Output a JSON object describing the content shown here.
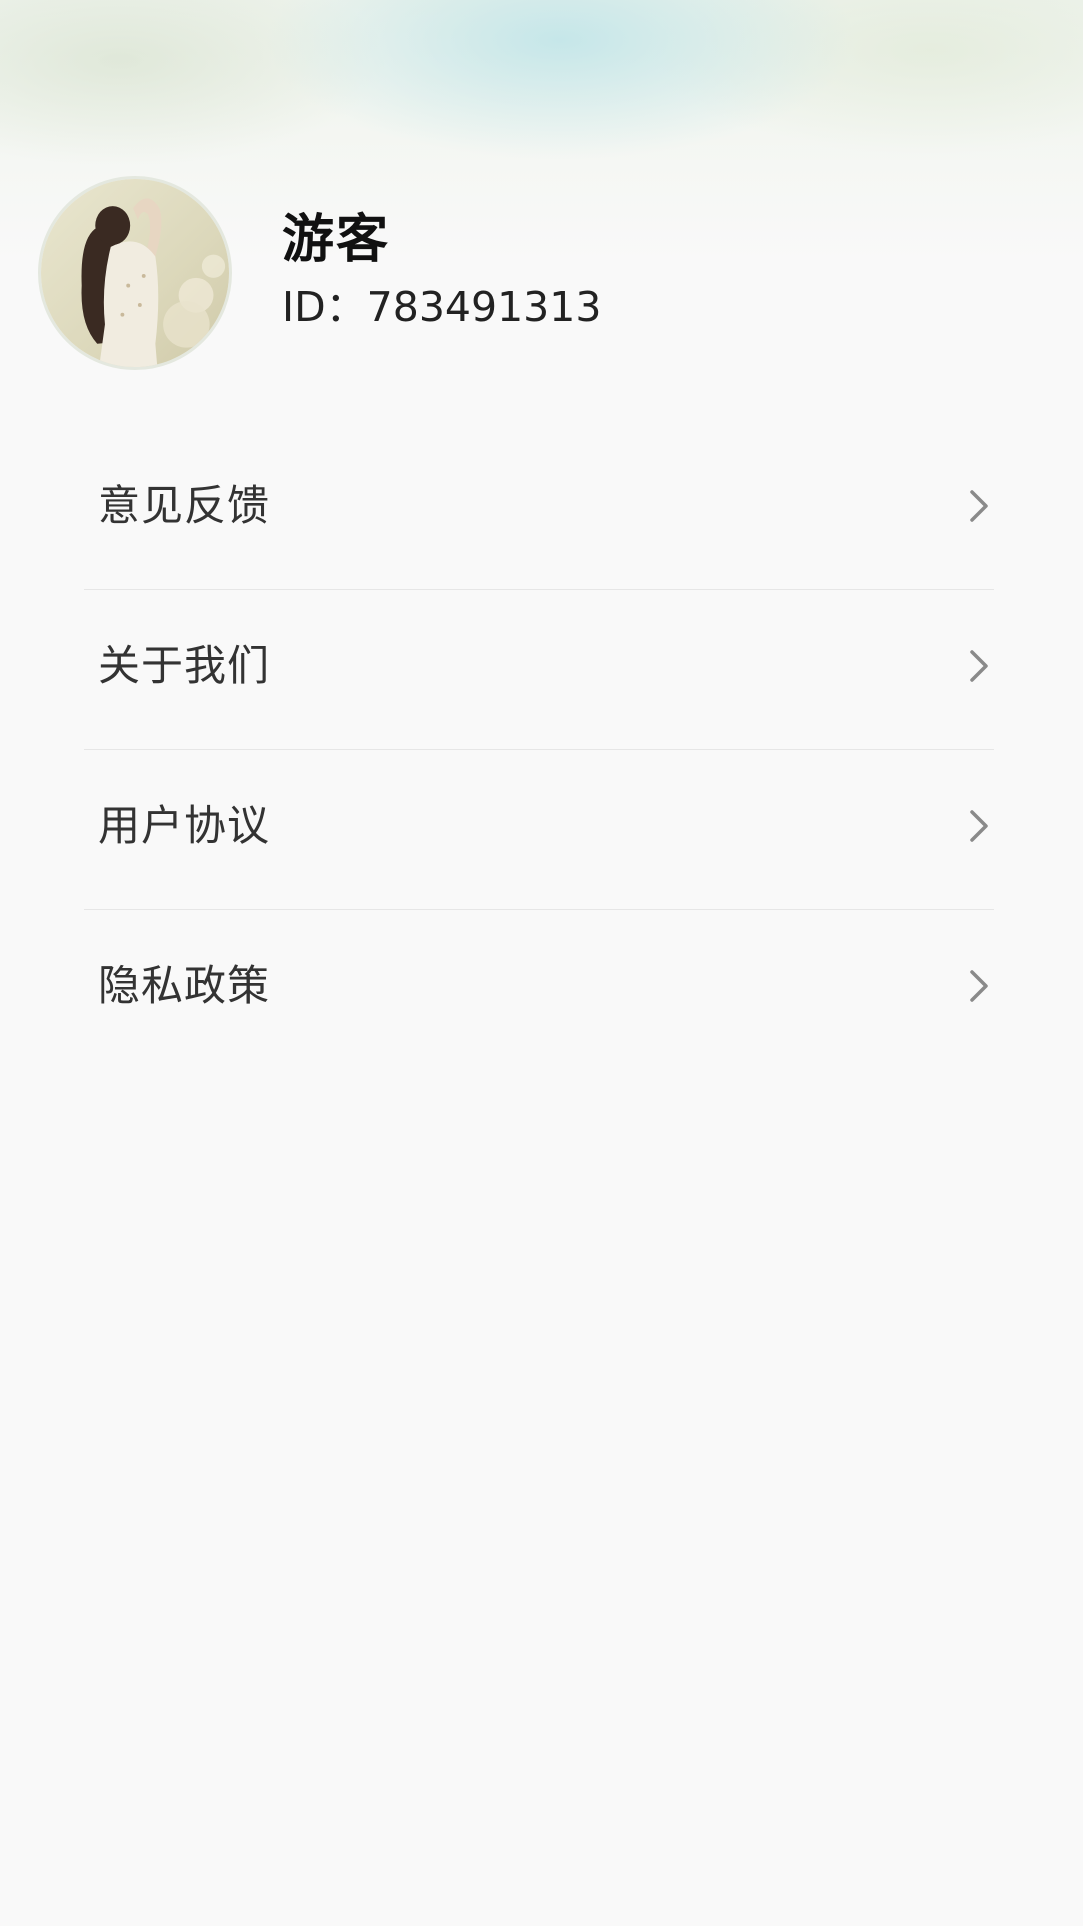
{
  "profile": {
    "name": "游客",
    "id_text": "ID：783491313",
    "avatar_icon": "avatar-photo"
  },
  "menu": {
    "items": [
      {
        "label": "意见反馈",
        "icon": "chevron-right-icon"
      },
      {
        "label": "关于我们",
        "icon": "chevron-right-icon"
      },
      {
        "label": "用户协议",
        "icon": "chevron-right-icon"
      },
      {
        "label": "隐私政策",
        "icon": "chevron-right-icon"
      }
    ]
  },
  "colors": {
    "background": "#f9f9f9",
    "text_primary": "#111111",
    "text_menu": "#333333",
    "chevron": "#8a8a8a",
    "divider": "#e6e6e6"
  }
}
